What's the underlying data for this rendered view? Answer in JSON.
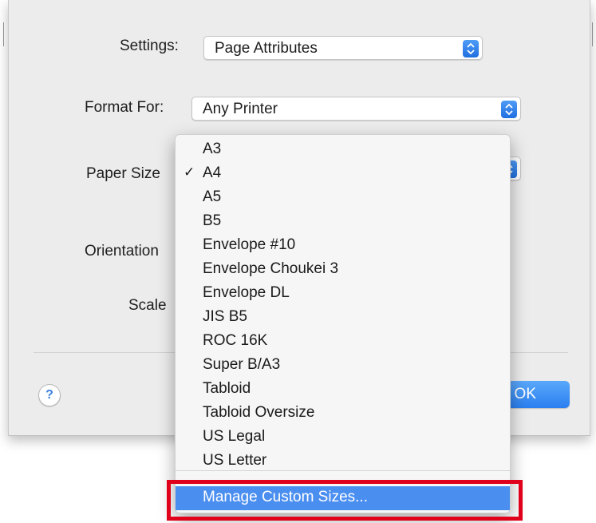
{
  "dialog": {
    "settings": {
      "label": "Settings:",
      "value": "Page Attributes"
    },
    "format_for": {
      "label": "Format For:",
      "value": "Any Printer"
    },
    "paper_size": {
      "label": "Paper Size"
    },
    "orientation": {
      "label": "Orientation"
    },
    "scale": {
      "label": "Scale"
    },
    "help_label": "?",
    "ok_label": "OK"
  },
  "paper_menu": {
    "selected": "A4",
    "check_glyph": "✓",
    "items": [
      "A3",
      "A4",
      "A5",
      "B5",
      "Envelope #10",
      "Envelope Choukei 3",
      "Envelope DL",
      "JIS B5",
      "ROC 16K",
      "Super B/A3",
      "Tabloid",
      "Tabloid Oversize",
      "US Legal",
      "US Letter"
    ],
    "manage_label": "Manage Custom Sizes..."
  },
  "colors": {
    "accent": "#4a8ef0",
    "highlight_frame": "#e0001b"
  }
}
